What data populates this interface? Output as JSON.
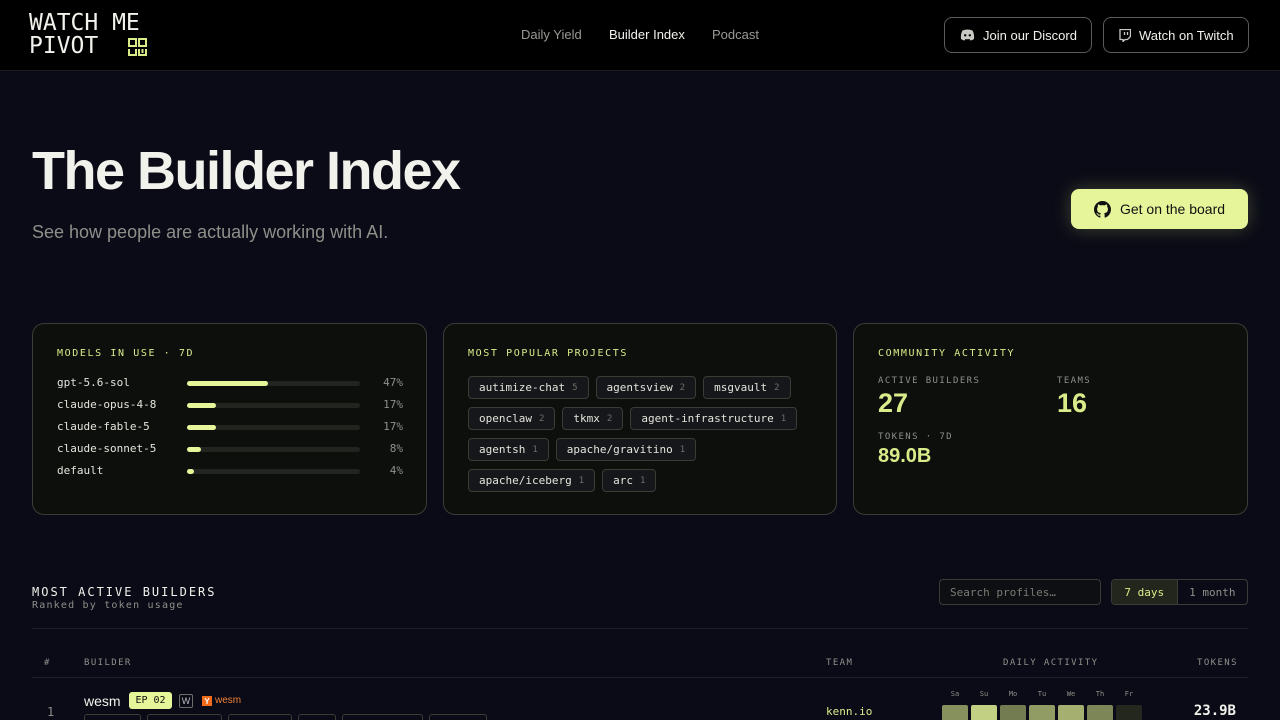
{
  "header": {
    "logo_line1": "WATCH ME",
    "logo_line2": "PIVOT",
    "nav": [
      "Daily Yield",
      "Builder Index",
      "Podcast"
    ],
    "discord_label": "Join our Discord",
    "twitch_label": "Watch on Twitch"
  },
  "hero": {
    "title": "The Builder Index",
    "subtitle": "See how people are actually working with AI.",
    "cta_label": "Get on the board"
  },
  "models": {
    "title": "MODELS IN USE · 7D",
    "rows": [
      {
        "name": "gpt-5.6-sol",
        "pct": "47%",
        "share": 0.47
      },
      {
        "name": "claude-opus-4-8",
        "pct": "17%",
        "share": 0.17
      },
      {
        "name": "claude-fable-5",
        "pct": "17%",
        "share": 0.17
      },
      {
        "name": "claude-sonnet-5",
        "pct": "8%",
        "share": 0.08
      },
      {
        "name": "default",
        "pct": "4%",
        "share": 0.04
      }
    ]
  },
  "projects": {
    "title": "MOST POPULAR PROJECTS",
    "items": [
      {
        "name": "autimize-chat",
        "count": "5"
      },
      {
        "name": "agentsview",
        "count": "2"
      },
      {
        "name": "msgvault",
        "count": "2"
      },
      {
        "name": "openclaw",
        "count": "2"
      },
      {
        "name": "tkmx",
        "count": "2"
      },
      {
        "name": "agent-infrastructure",
        "count": "1"
      },
      {
        "name": "agentsh",
        "count": "1"
      },
      {
        "name": "apache/gravitino",
        "count": "1"
      },
      {
        "name": "apache/iceberg",
        "count": "1"
      },
      {
        "name": "arc",
        "count": "1"
      }
    ]
  },
  "community": {
    "title": "COMMUNITY ACTIVITY",
    "active_label": "ACTIVE BUILDERS",
    "active_value": "27",
    "teams_label": "TEAMS",
    "teams_value": "16",
    "tokens_label": "TOKENS · 7D",
    "tokens_value": "89.0B"
  },
  "builders": {
    "title": "MOST ACTIVE BUILDERS",
    "subtitle": "Ranked by token usage",
    "search_placeholder": "Search profiles…",
    "range_options": [
      "7 days",
      "1 month"
    ],
    "columns": {
      "rank": "#",
      "builder": "BUILDER",
      "team": "TEAM",
      "activity": "DAILY ACTIVITY",
      "tokens": "TOKENS"
    },
    "rows": [
      {
        "rank": "1",
        "name": "wesm",
        "episode": "EP 02",
        "w_badge": "W",
        "yc_badge": "Y",
        "yc_name": "wesm",
        "team": "kenn.io",
        "tokens": "23.9B",
        "days": [
          {
            "label": "Sa",
            "level": 0.55
          },
          {
            "label": "Su",
            "level": 0.85
          },
          {
            "label": "Mo",
            "level": 0.45
          },
          {
            "label": "Tu",
            "level": 0.6
          },
          {
            "label": "We",
            "level": 0.7
          },
          {
            "label": "Th",
            "level": 0.5
          },
          {
            "label": "Fr",
            "level": 0.05
          }
        ]
      }
    ]
  },
  "colors": {
    "accent": "#e6f59a",
    "background": "#0a0b16",
    "youtube_orange": "#f26a1b"
  }
}
